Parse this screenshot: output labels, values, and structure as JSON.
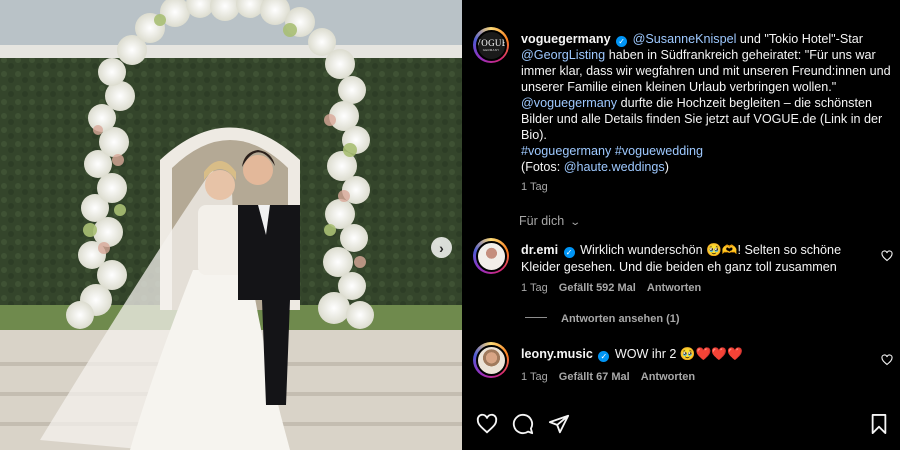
{
  "post": {
    "username": "voguegermany",
    "avatar_text": "VOGUE",
    "avatar_subtext": "GERMANY",
    "caption": {
      "mention1": "@SusanneKnispel",
      "text1": " und \"Tokio Hotel\"-Star ",
      "mention2": "@GeorgListing",
      "text2": " haben in Südfrankreich geheiratet: \"Für uns war immer klar, dass wir wegfahren und mit unseren Freund:innen und unserer Familie einen kleinen Urlaub verbringen wollen.\" ",
      "mention3": "@voguegermany",
      "text3": " durfte die Hochzeit begleiten – die schönsten Bilder und alle Details finden Sie jetzt auf VOGUE.de (Link in der Bio).",
      "hashtags": "#voguegermany #voguewedding",
      "photo_credit_prefix": "(Fotos: ",
      "photo_credit_mention": "@haute.weddings",
      "photo_credit_suffix": ")"
    },
    "time": "1 Tag",
    "for_you": "Für dich"
  },
  "comments": [
    {
      "username": "dr.emi",
      "text": "Wirklich wunderschön 🥹🫶! Selten so schöne Kleider gesehen. Und die beiden eh ganz toll zusammen",
      "time": "1 Tag",
      "likes": "Gefällt 592 Mal",
      "reply": "Antworten",
      "view_replies": "Antworten ansehen (1)"
    },
    {
      "username": "leony.music",
      "text": "WOW ihr 2 🥹❤️❤️❤️",
      "time": "1 Tag",
      "likes": "Gefällt 67 Mal",
      "reply": "Antworten"
    }
  ],
  "icons": {
    "verified": "verified-badge-icon",
    "next": "chevron-right-icon",
    "like": "heart-icon",
    "comment": "comment-icon",
    "share": "paper-plane-icon",
    "save": "bookmark-icon"
  },
  "colors": {
    "background": "#000000",
    "text": "#f5f5f5",
    "secondary_text": "#a8a8a8",
    "link": "#b3d3f5",
    "verified_blue": "#0095f6"
  }
}
